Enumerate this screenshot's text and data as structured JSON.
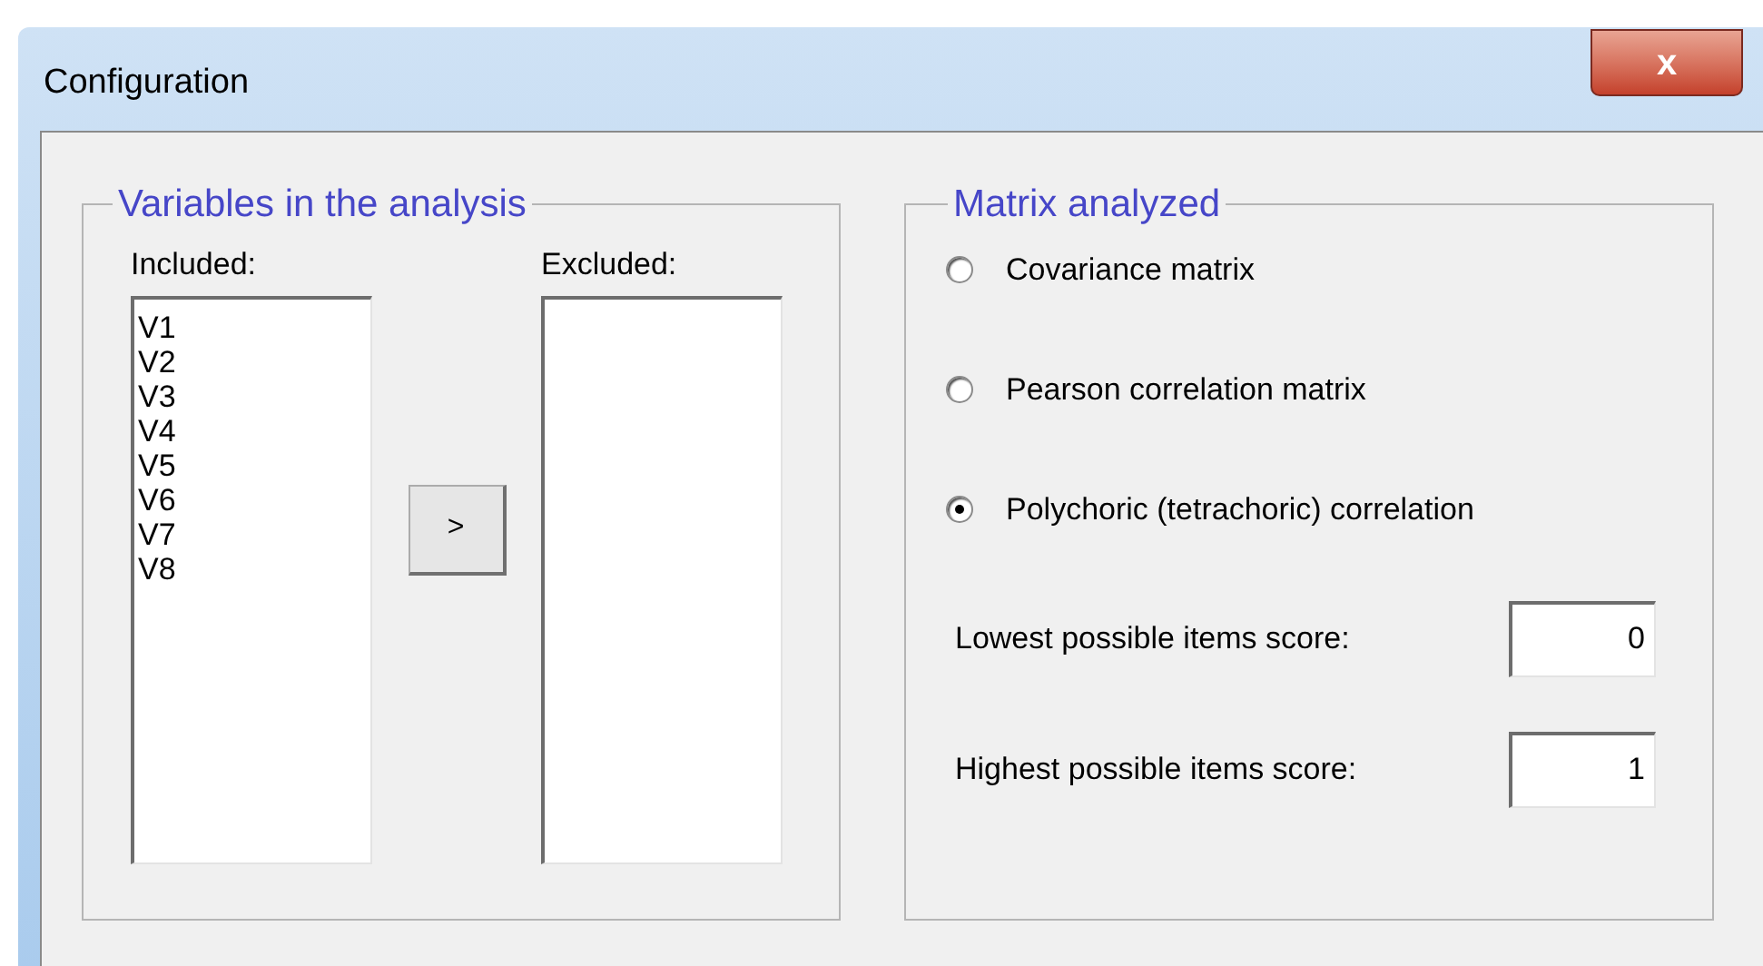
{
  "window": {
    "title": "Configuration",
    "close": "x"
  },
  "variables": {
    "title": "Variables in the analysis",
    "included_label": "Included:",
    "excluded_label": "Excluded:",
    "included": [
      "V1",
      "V2",
      "V3",
      "V4",
      "V5",
      "V6",
      "V7",
      "V8"
    ],
    "move_button": ">"
  },
  "matrix": {
    "title": "Matrix analyzed",
    "options": [
      {
        "label": "Covariance matrix",
        "selected": false
      },
      {
        "label": "Pearson correlation matrix",
        "selected": false
      },
      {
        "label": "Polychoric (tetrachoric) correlation",
        "selected": true
      }
    ],
    "fields": [
      {
        "label": "Lowest possible items score:",
        "value": "0"
      },
      {
        "label": "Highest possible items score:",
        "value": "1"
      }
    ]
  }
}
